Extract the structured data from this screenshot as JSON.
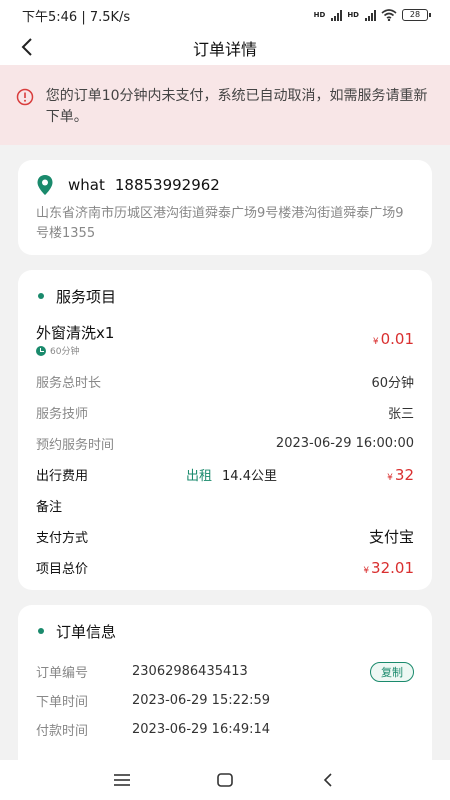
{
  "status_bar": {
    "time_speed": "下午5:46 | 7.5K/s",
    "battery": "28",
    "hd1": "HD",
    "hd2": "HD"
  },
  "nav": {
    "title": "订单详情",
    "back_icon": "chevron-left-icon"
  },
  "notice": {
    "text": "您的订单10分钟内未支付，系统已自动取消，如需服务请重新下单。",
    "icon": "alert-circle-icon",
    "color": "#d93d3d"
  },
  "address": {
    "name": "what",
    "phone": "18853992962",
    "detail": "山东省济南市历城区港沟街道舜泰广场9号楼港沟街道舜泰广场9号楼1355",
    "icon": "location-pin-icon"
  },
  "service": {
    "title": "服务项目",
    "item_name": "外窗清洗x1",
    "item_duration": "60分钟",
    "currency": "¥",
    "item_price": "0.01",
    "total_duration_label": "服务总时长",
    "total_duration": "60分钟",
    "technician_label": "服务技师",
    "technician": "张三",
    "appointment_label": "预约服务时间",
    "appointment": "2023-06-29 16:00:00",
    "travel_label": "出行费用",
    "travel_type": "出租",
    "travel_distance": "14.4公里",
    "travel_fee": "32",
    "remark_label": "备注",
    "payment_label": "支付方式",
    "payment": "支付宝",
    "total_label": "项目总价",
    "total": "32.01"
  },
  "order_info": {
    "title": "订单信息",
    "number_label": "订单编号",
    "number": "23062986435413",
    "copy_label": "复制",
    "created_label": "下单时间",
    "created": "2023-06-29 15:22:59",
    "paid_label": "付款时间",
    "paid": "2023-06-29 16:49:14"
  },
  "colors": {
    "accent": "#1a8a6c",
    "price": "#d92f2f",
    "notice_bg": "#f8e6e7"
  },
  "system_nav": {
    "menu_icon": "menu-icon",
    "home_icon": "home-square-icon",
    "back_icon": "back-triangle-icon"
  }
}
